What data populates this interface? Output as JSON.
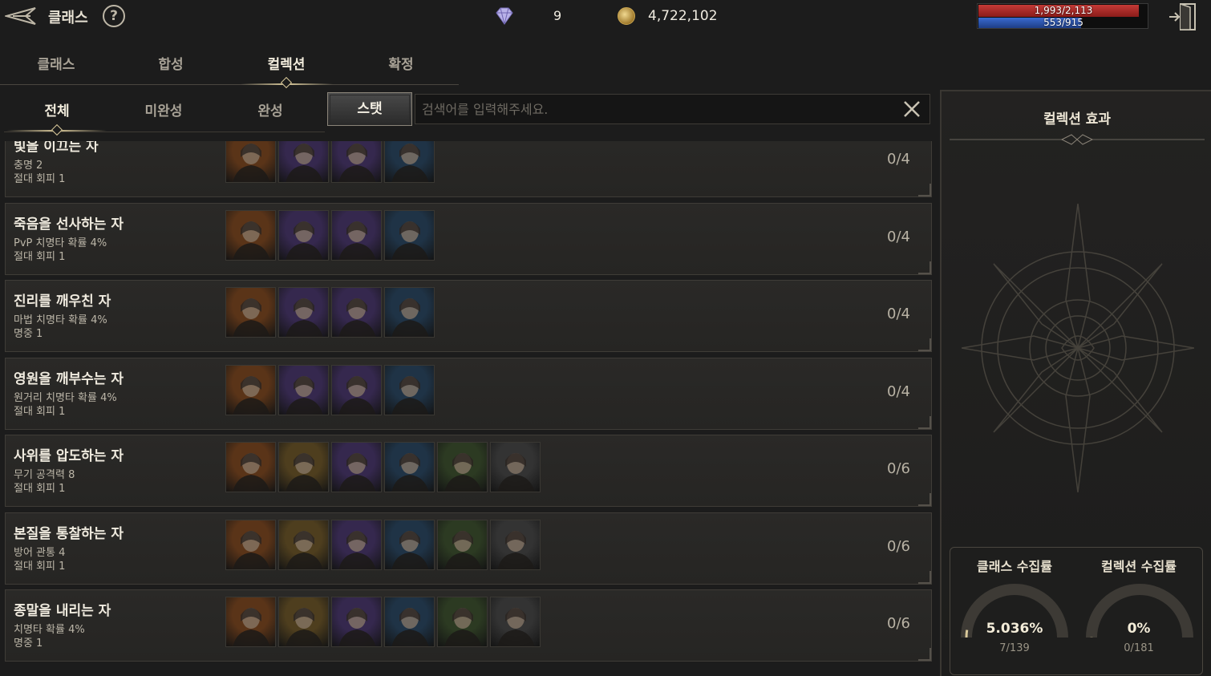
{
  "header": {
    "title": "클래스",
    "help_label": "?",
    "gem_count": "9",
    "gold_count": "4,722,102",
    "hp_text": "1,993/2,113",
    "mp_text": "553/915",
    "hp_fraction": 0.943,
    "mp_fraction": 0.604
  },
  "main_tabs": [
    "클래스",
    "합성",
    "컬렉션",
    "확정"
  ],
  "main_active": 2,
  "sub_tabs": [
    "전체",
    "미완성",
    "완성"
  ],
  "sub_active": 0,
  "stat_button": "스탯",
  "search": {
    "placeholder": "검색어를 입력해주세요.",
    "value": "",
    "clear_label": "X"
  },
  "collections": [
    {
      "name": "빛을 이끄는 자",
      "stat1": "충명 2",
      "stat2": "절대 회피 1",
      "count": "0/4",
      "portraits": [
        "orange",
        "purple",
        "purple",
        "blue"
      ]
    },
    {
      "name": "죽음을 선사하는 자",
      "stat1": "PvP 치명타 확률 4%",
      "stat2": "절대 회피 1",
      "count": "0/4",
      "portraits": [
        "orange",
        "purple",
        "purple",
        "blue"
      ]
    },
    {
      "name": "진리를 깨우친 자",
      "stat1": "마법 치명타 확률 4%",
      "stat2": "명중 1",
      "count": "0/4",
      "portraits": [
        "orange",
        "purple",
        "purple",
        "blue"
      ]
    },
    {
      "name": "영원을 깨부수는 자",
      "stat1": "원거리 치명타 확률 4%",
      "stat2": "절대 회피 1",
      "count": "0/4",
      "portraits": [
        "orange",
        "purple",
        "purple",
        "blue"
      ]
    },
    {
      "name": "사위를 압도하는 자",
      "stat1": "무기 공격력 8",
      "stat2": "절대 회피 1",
      "count": "0/6",
      "portraits": [
        "orange",
        "gold",
        "purple",
        "blue",
        "green",
        "gray"
      ]
    },
    {
      "name": "본질을 통찰하는 자",
      "stat1": "방어 관통 4",
      "stat2": "절대 회피 1",
      "count": "0/6",
      "portraits": [
        "orange",
        "gold",
        "purple",
        "blue",
        "green",
        "gray"
      ]
    },
    {
      "name": "종말을 내리는 자",
      "stat1": "치명타 확률 4%",
      "stat2": "명중 1",
      "count": "0/6",
      "portraits": [
        "orange",
        "gold",
        "purple",
        "blue",
        "green",
        "gray"
      ]
    }
  ],
  "panel": {
    "title": "컬렉션 효과",
    "class_rate_label": "클래스 수집률",
    "class_rate_pct": "5.036%",
    "class_rate_count": "7/139",
    "class_rate_value": 0.05036,
    "collection_rate_label": "컬렉션 수집률",
    "collection_rate_pct": "0%",
    "collection_rate_count": "0/181",
    "collection_rate_value": 0
  },
  "colors": {
    "orange": "#5a3418",
    "purple": "#35284e",
    "blue": "#1f3346",
    "gold": "#4e3e1e",
    "green": "#2c3a22",
    "gray": "#333333",
    "accent": "#d8c89a"
  }
}
